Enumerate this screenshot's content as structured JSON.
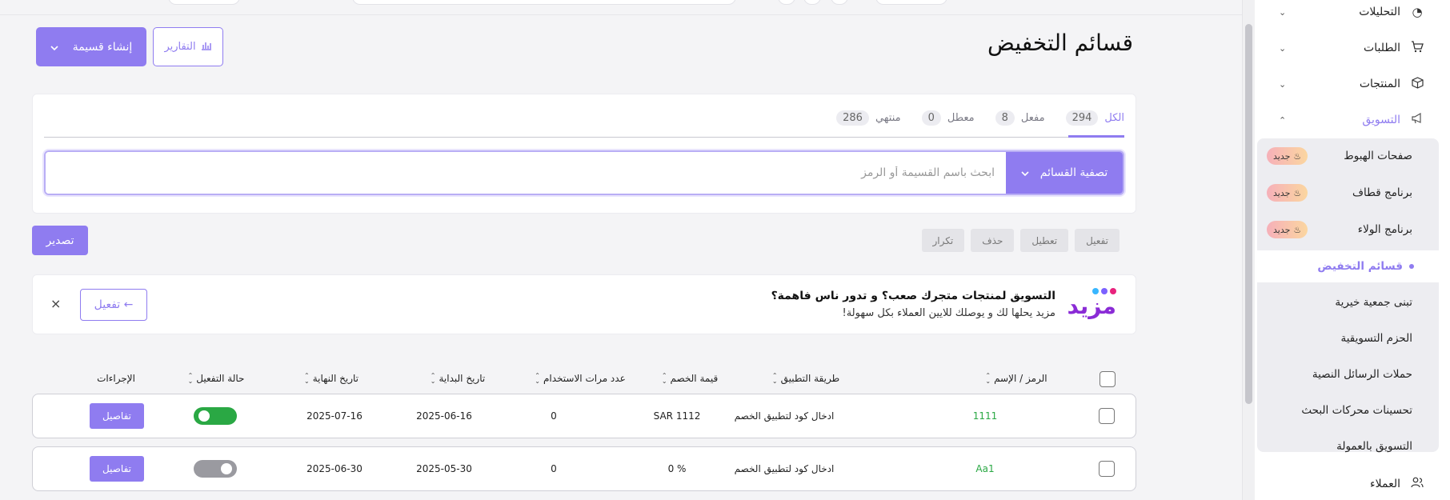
{
  "page": {
    "title": "قسائم التخفيض",
    "create_button": "إنشاء قسيمة",
    "reports_button": "التقارير"
  },
  "tabs": [
    {
      "label": "الكل",
      "count": "294"
    },
    {
      "label": "مفعل",
      "count": "8"
    },
    {
      "label": "معطل",
      "count": "0"
    },
    {
      "label": "منتهي",
      "count": "286"
    }
  ],
  "search": {
    "placeholder": "ابحث باسم القسيمة أو الرمز",
    "filter_label": "تصفية القسائم"
  },
  "bulk_actions": [
    "تفعيل",
    "تعطيل",
    "حذف",
    "تكرار"
  ],
  "export_button": "تصدير",
  "promo": {
    "logo_text": "مزيد",
    "title": "التسويق لمنتجات متجرك صعب؟ و تدور ناس فاهمة؟",
    "subtitle": "مزيد يحلها لك و يوصلك للايين العملاء بكل سهولة!",
    "activate_label": "تفعيل ←",
    "close_label": "×",
    "colors": {
      "accent": "#8a2bd6",
      "dot1": "#e8227d",
      "dot2": "#7b61ff",
      "dot3": "#38b6ff"
    }
  },
  "table": {
    "headers": [
      "الرمز / الإسم",
      "طريقة التطبيق",
      "قيمة الخصم",
      "عدد مرات الاستخدام",
      "تاريخ البداية",
      "تاريخ النهاية",
      "حالة التفعيل",
      "الإجراءات"
    ],
    "rows": [
      {
        "code": "1111",
        "method": "ادخال كود لتطبيق الخصم",
        "value": "SAR 1112",
        "uses": "0",
        "start": "2025-06-16",
        "end": "2025-07-16",
        "active": true,
        "action": "تفاصيل"
      },
      {
        "code": "Aa1",
        "method": "ادخال كود لتطبيق الخصم",
        "value": "0 %",
        "uses": "0",
        "start": "2025-05-30",
        "end": "2025-06-30",
        "active": false,
        "action": "تفاصيل"
      }
    ]
  },
  "sidebar": {
    "items": [
      {
        "label": "التحليلات",
        "icon": "chart-pie-icon"
      },
      {
        "label": "الطلبات",
        "icon": "cart-icon"
      },
      {
        "label": "المنتجات",
        "icon": "box-icon"
      },
      {
        "label": "التسويق",
        "icon": "megaphone-icon"
      }
    ],
    "marketing_sub": [
      {
        "label": "صفحات الهبوط",
        "badge": "جديد"
      },
      {
        "label": "برنامج قطاف",
        "badge": "جديد"
      },
      {
        "label": "برنامج الولاء",
        "badge": "جديد"
      },
      {
        "label": "قسائم التخفيض",
        "badge": ""
      },
      {
        "label": "تبنى جمعية خيرية",
        "badge": ""
      },
      {
        "label": "الحزم التسويقية",
        "badge": ""
      },
      {
        "label": "حملات الرسائل النصية",
        "badge": ""
      },
      {
        "label": "تحسينات محركات البحث",
        "badge": ""
      },
      {
        "label": "التسويق بالعمولة",
        "badge": ""
      }
    ],
    "customers": {
      "label": "العملاء",
      "icon": "users-icon"
    }
  },
  "colors": {
    "primary": "#8f7cf0",
    "success": "#2aa844",
    "toggle_on": "#2aa844",
    "toggle_off": "#9a9aa0"
  }
}
